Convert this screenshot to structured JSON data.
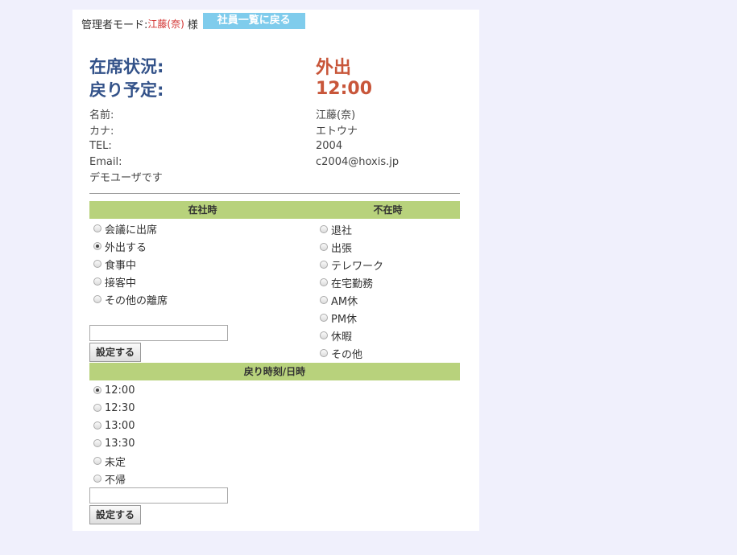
{
  "header": {
    "mode_label": "管理者モード:",
    "user_name": "江藤(奈)",
    "honorific": "様",
    "back_button": "社員一覧に戻る"
  },
  "status": {
    "presence_label": "在席状況:",
    "presence_value": "外出",
    "return_label": "戻り予定:",
    "return_value": "12:00"
  },
  "profile": {
    "name_label": "名前:",
    "name_value": "江藤(奈)",
    "kana_label": "カナ:",
    "kana_value": "エトウナ",
    "tel_label": "TEL:",
    "tel_value": "2004",
    "email_label": "Email:",
    "email_value": "c2004@hoxis.jp",
    "note": "デモユーザです"
  },
  "in_office": {
    "header": "在社時",
    "options": [
      {
        "label": "会議に出席",
        "checked": false
      },
      {
        "label": "外出する",
        "checked": true
      },
      {
        "label": "食事中",
        "checked": false
      },
      {
        "label": "接客中",
        "checked": false
      },
      {
        "label": "その他の離席",
        "checked": false
      }
    ],
    "input_value": "",
    "set_button": "設定する"
  },
  "absent": {
    "header": "不在時",
    "options": [
      {
        "label": "退社",
        "checked": false
      },
      {
        "label": "出張",
        "checked": false
      },
      {
        "label": "テレワーク",
        "checked": false
      },
      {
        "label": "在宅勤務",
        "checked": false
      },
      {
        "label": "AM休",
        "checked": false
      },
      {
        "label": "PM休",
        "checked": false
      },
      {
        "label": "休暇",
        "checked": false
      },
      {
        "label": "その他",
        "checked": false
      }
    ]
  },
  "return_time": {
    "header": "戻り時刻/日時",
    "options": [
      {
        "label": "12:00",
        "checked": true
      },
      {
        "label": "12:30",
        "checked": false
      },
      {
        "label": "13:00",
        "checked": false
      },
      {
        "label": "13:30",
        "checked": false
      },
      {
        "label": "未定",
        "checked": false
      },
      {
        "label": "不帰",
        "checked": false
      }
    ],
    "input_value": "",
    "set_button": "設定する"
  }
}
